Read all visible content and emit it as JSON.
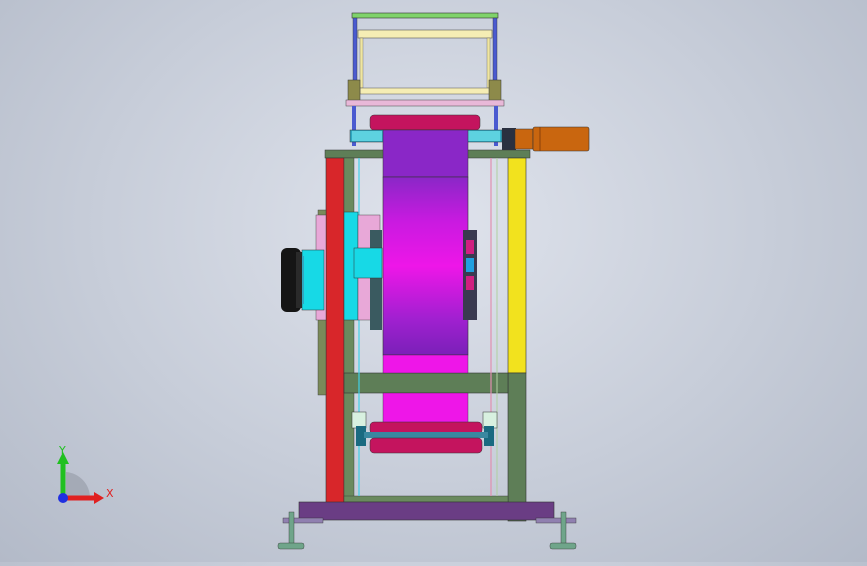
{
  "viewport": {
    "background_color": "#c9cfdb",
    "model_colors": {
      "frame_red": "#d8262a",
      "frame_yellow": "#f2e21e",
      "frame_green": "#5e7e57",
      "drum_magenta": "#ee16e8",
      "drum_purple": "#8a27c7",
      "roller_crimson": "#c4145e",
      "hub_cyan": "#17d9e6",
      "motor_black": "#151515",
      "shaft_orange": "#c9660f",
      "base_purple": "#6a3d84",
      "foot_green": "#6fa58a",
      "top_frame_cream": "#f5edb4",
      "post_olive": "#8d8a4a"
    }
  },
  "triad": {
    "x_label": "X",
    "y_label": "Y",
    "x_color": "#e02020",
    "y_color": "#20c020",
    "origin_color": "#2030e0"
  }
}
